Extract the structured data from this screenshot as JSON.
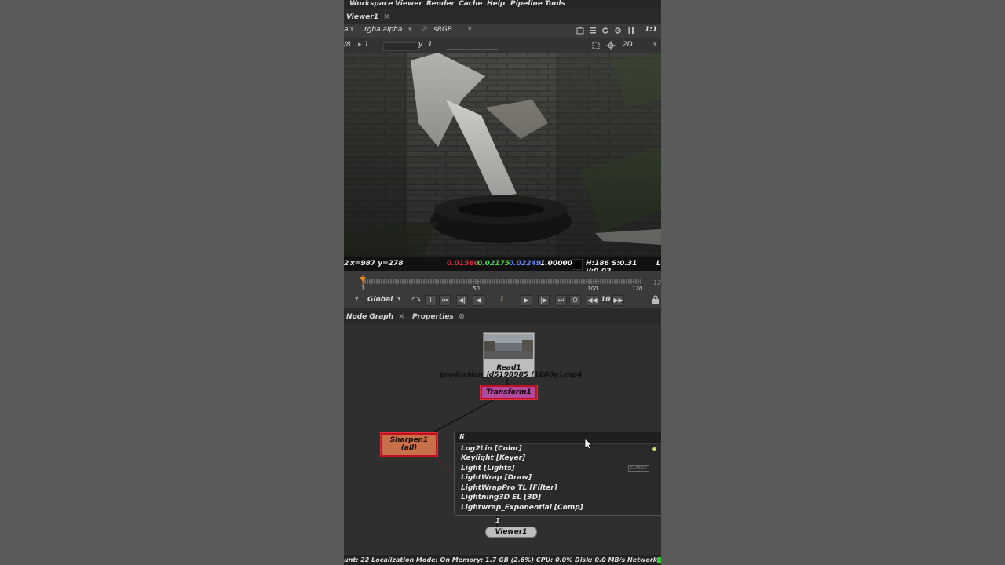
{
  "menubar": [
    "Workspace",
    "Viewer",
    "Render",
    "Cache",
    "Help",
    "Pipeline Tools"
  ],
  "viewer_tab": "Viewer1",
  "toolbar1": {
    "channel_a": "a",
    "channel": "rgba.alpha",
    "ip": "IP",
    "colorspace": "sRGB",
    "zoom": "1:1"
  },
  "toolbar2": {
    "proxy": "/8",
    "gain_value": "1",
    "gamma_label": "y",
    "gamma_value": "1",
    "view_mode": "2D"
  },
  "viewer_info": {
    "frame_prefix": "2",
    "coords": "x=987 y=278",
    "r": "0.01560",
    "g": "0.02175",
    "b": "0.02249",
    "a": "1.00000",
    "hsv": "H:186 S:0.31 V:0.02",
    "suffix": "L"
  },
  "timeline": {
    "ticks": [
      "1",
      "50",
      "100",
      "120"
    ],
    "end_label": "12",
    "current": 1
  },
  "playback": {
    "scope": "Global",
    "in_label": "I",
    "frame": "1",
    "out_label": "O",
    "increment": "10"
  },
  "tabs": {
    "node_graph": "Node Graph",
    "properties": "Properties"
  },
  "nodes": {
    "read": "Read1",
    "read_file": "production_id5198985 (1080p).mp4",
    "transform": "Transform1",
    "sharpen": "Sharpen1",
    "sharpen_sub": "(all)",
    "viewer": "Viewer1",
    "viewer_input": "1"
  },
  "tab_menu": {
    "query": "li",
    "items": [
      "Log2Lin [Color]",
      "Keylight [Keyer]",
      "Light [Lights]",
      "LightWrap [Draw]",
      "LightWrapPro TL [Filter]",
      "Lightning3D EL [3D]",
      "Lightwrap_Exponential [Comp]"
    ],
    "badge": "CLASSIC"
  },
  "status": "unt: 22  Localization Mode: On  Memory: 1.7 GB (2.6%)  CPU: 0.0%  Disk: 0.0 MB/s  Network:",
  "colors": {
    "red": "#e0304a",
    "green": "#4cd44c",
    "blue": "#5a7cff",
    "accent": "#e08a20"
  }
}
